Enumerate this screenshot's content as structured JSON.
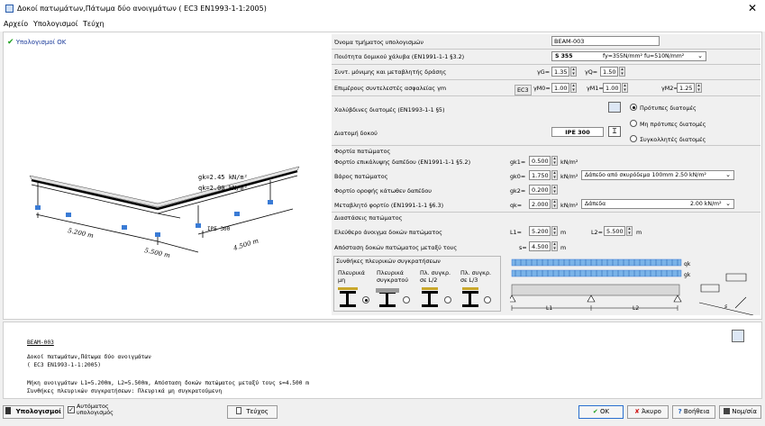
{
  "window": {
    "title": "Δοκοί πατωμάτων,Πάτωμα δύο ανοιγμάτων ( EC3 EN1993-1-1:2005)",
    "close": "✕"
  },
  "menu": [
    "Αρχείο",
    "Υπολογισμοί",
    "Τεύχη"
  ],
  "status": {
    "ok_text": "Υπολογισμοί OK"
  },
  "diagram": {
    "loads": [
      "gk=2.45 kN/m²",
      "qk=2.00 kN/m²"
    ],
    "dims": [
      "5.200 m",
      "5.500 m",
      "4.500 m"
    ],
    "section": "IPE 300"
  },
  "form": {
    "name_label": "Όνομα τμήματος υπολογισμών",
    "name_value": "BEAM-003",
    "steel_label": "Ποιότητα δομικού χάλυβα (EN1991-1-1 §3.2)",
    "steel_value": "S 355",
    "steel_props": "fy=355N/mm² fu=510N/mm²",
    "coef_label": "Συντ. μόνιμης και μεταβλητής δράσης",
    "gG_label": "γG=",
    "gG_value": "1.35",
    "gQ_label": "γQ=",
    "gQ_value": "1.50",
    "partial_label": "Επιμέρους συντελεστές ασφαλείας γm",
    "ec3": "EC3",
    "gM0_label": "γM0=",
    "gM0_value": "1.00",
    "gM1_label": "γM1=",
    "gM1_value": "1.00",
    "gM2_label": "γM2=",
    "gM2_value": "1.25",
    "steel_sections_label": "Χαλύβδινες διατομές (EN1993-1-1 §5)",
    "beam_section_label": "Διατομή δοκού",
    "beam_section_value": "IPE 300",
    "radio_standard": "Πρότυπες διατομές",
    "radio_nonstandard": "Μη πρότυπες διατομές",
    "radio_welded": "Συγκολλητές διατομές",
    "floor_loads_title": "Φορτία πατώματος",
    "gk1_desc": "Φορτίο επικάλυψης δαπέδου (EN1991-1-1 §5.2)",
    "gk1_label": "gk1=",
    "gk1_value": "0.500",
    "gk1_unit": "kN/m²",
    "gk0_desc": "Βάρος πατώματος",
    "gk0_label": "gk0=",
    "gk0_value": "1.750",
    "gk0_unit": "kN/m²",
    "gk0_select": "Δάπεδο από σκυρόδεμα 100mm   2.50 kN/m²",
    "gk2_desc": "Φορτίο οροφής κάτωθεν δαπέδου",
    "gk2_label": "gk2=",
    "gk2_value": "0.200",
    "qk_desc": "Μεταβλητό φορτίο (EN1991-1-1 §6.3)",
    "qk_label": "qk=",
    "qk_value": "2.000",
    "qk_unit": "kN/m²",
    "qk_select": "Δάπεδα",
    "qk_select_val": "2.00 kN/m²",
    "dims_title": "Διαστάσεις πατώματος",
    "spans_desc": "Ελεύθερο άνοιγμα δοκών πατώματος",
    "L1_label": "L1=",
    "L1_value": "5.200",
    "L1_unit": "m",
    "L2_label": "L2=",
    "L2_value": "5.500",
    "L2_unit": "m",
    "s_desc": "Απόσταση δοκών πατώματος μεταξύ τους",
    "s_label": "s=",
    "s_value": "4.500",
    "s_unit": "m",
    "restraint_title": "Συνθήκες πλευρικών συγκρατήσεων",
    "restraints": [
      {
        "l1": "Πλευρικά",
        "l2": "μη"
      },
      {
        "l1": "Πλευρικά",
        "l2": "συγκρατού"
      },
      {
        "l1": "Πλ. συγκρ.",
        "l2": "σε L/2"
      },
      {
        "l1": "Πλ. συγκρ.",
        "l2": "σε L/3"
      }
    ],
    "scheme": {
      "qk": "qk",
      "gk": "gk",
      "L1": "L1",
      "L2": "L2",
      "s": "s"
    }
  },
  "report": {
    "lines": [
      "BEAM-003",
      "Δοκοί πατωμάτων,Πάτωμα δύο ανοιγμάτων",
      "( EC3 EN1993-1-1:2005)",
      "Μήκη ανοιγμάτων L1=5.200m, L2=5.500m, Απόσταση δοκών πατώματος μεταξύ τους s=4.500 m",
      "Συνθήκες πλευρικών συγκρατήσεων: Πλευρικά μη συγκρατούμενη"
    ]
  },
  "bottom": {
    "calc": "Υπολογισμοί",
    "auto": "Αυτόματος\nυπολογισμός",
    "docs": "Τεύχος",
    "ok": "OK",
    "cancel": "Άκυρο",
    "help": "Βοήθεια",
    "units": "Νομ/σία"
  }
}
